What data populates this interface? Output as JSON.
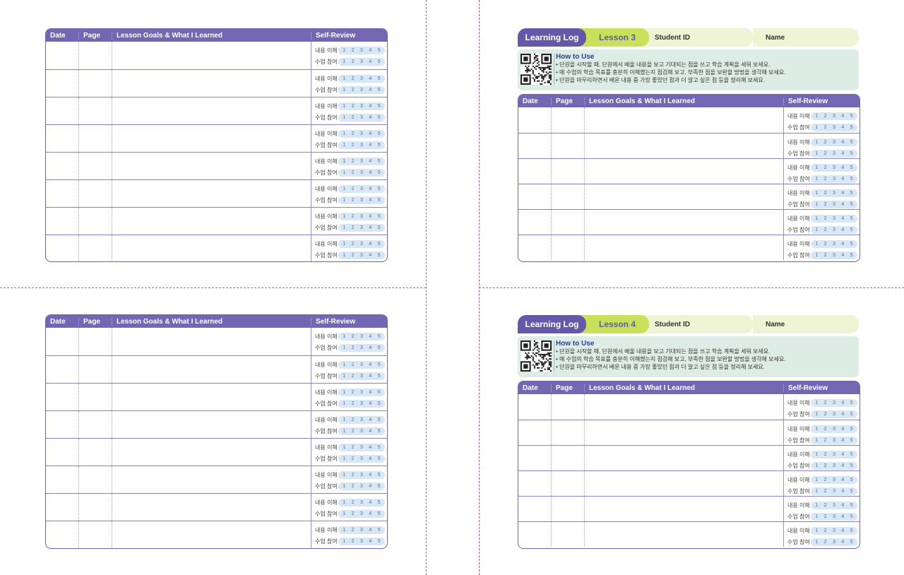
{
  "table_header": {
    "date": "Date",
    "page": "Page",
    "goals": "Lesson Goals & What I Learned",
    "self_review": "Self-Review"
  },
  "review_labels": {
    "understanding": "내용 이해",
    "participation": "수업 참여"
  },
  "scale": [
    "1",
    "2",
    "3",
    "4",
    "5"
  ],
  "log_header": {
    "learning_log": "Learning Log",
    "student_id": "Student ID",
    "name": "Name"
  },
  "lessons": {
    "lesson3": "Lesson 3",
    "lesson4": "Lesson 4"
  },
  "how_to_use": {
    "title": "How to Use",
    "line1": "• 단원을 시작할 때, 단원에서 배울 내용을 보고 기대되는 점을 쓰고 학습 계획을 세워 보세요.",
    "line2": "• 매 수업의 학습 목표를 충분히 이해했는지 점검해 보고, 부족한 점을 보완할 방법을 생각해 보세요.",
    "line3": "• 단원을 마무리하면서 배운 내용 중 가장 좋았던 점과 더 알고 싶은 점 등을 정리해 보세요."
  },
  "colors": {
    "purple": "#7367b3",
    "lime": "#c9e05a",
    "pale_lime": "#eef4d4",
    "mint": "#ddede6",
    "pill": "#d8e7f6",
    "cutline": "#d44c9e"
  }
}
